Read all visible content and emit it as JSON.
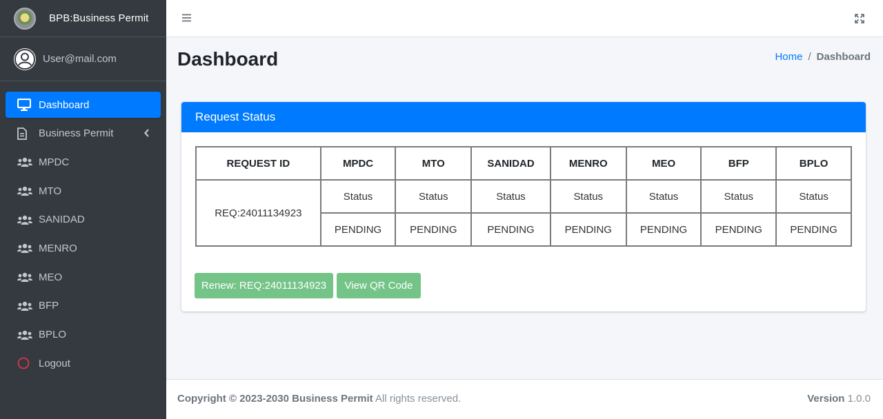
{
  "brand": {
    "title": "BPB:Business Permit",
    "icon": "seal-logo"
  },
  "user": {
    "email": "User@mail.com",
    "icon": "user-circle-icon"
  },
  "sidebar": {
    "items": [
      {
        "label": "Dashboard",
        "icon": "desktop-icon",
        "active": true
      },
      {
        "label": "Business Permit",
        "icon": "file-icon",
        "has_submenu": true
      },
      {
        "label": "MPDC",
        "icon": "users-icon"
      },
      {
        "label": "MTO",
        "icon": "users-icon"
      },
      {
        "label": "SANIDAD",
        "icon": "users-icon"
      },
      {
        "label": "MENRO",
        "icon": "users-icon"
      },
      {
        "label": "MEO",
        "icon": "users-icon"
      },
      {
        "label": "BFP",
        "icon": "users-icon"
      },
      {
        "label": "BPLO",
        "icon": "users-icon"
      },
      {
        "label": "Logout",
        "icon": "circle-icon"
      }
    ]
  },
  "header": {
    "title": "Dashboard",
    "breadcrumb": {
      "home": "Home",
      "separator": "/",
      "current": "Dashboard"
    }
  },
  "card": {
    "title": "Request Status",
    "table": {
      "headers": [
        "REQUEST ID",
        "MPDC",
        "MTO",
        "SANIDAD",
        "MENRO",
        "MEO",
        "BFP",
        "BPLO"
      ],
      "request_id": "REQ:24011134923",
      "status_label": "Status",
      "statuses": [
        "PENDING",
        "PENDING",
        "PENDING",
        "PENDING",
        "PENDING",
        "PENDING",
        "PENDING"
      ]
    },
    "buttons": {
      "renew": "Renew: REQ:24011134923",
      "qr": "View QR Code"
    }
  },
  "footer": {
    "copyright": "Copyright © 2023-2030 Business Permit",
    "rights": "All rights reserved.",
    "version_label": "Version",
    "version": "1.0.0"
  },
  "colors": {
    "sidebar_bg": "#343a40",
    "primary": "#007bff",
    "success_btn": "#74c487",
    "logout_icon": "#dc3545"
  }
}
